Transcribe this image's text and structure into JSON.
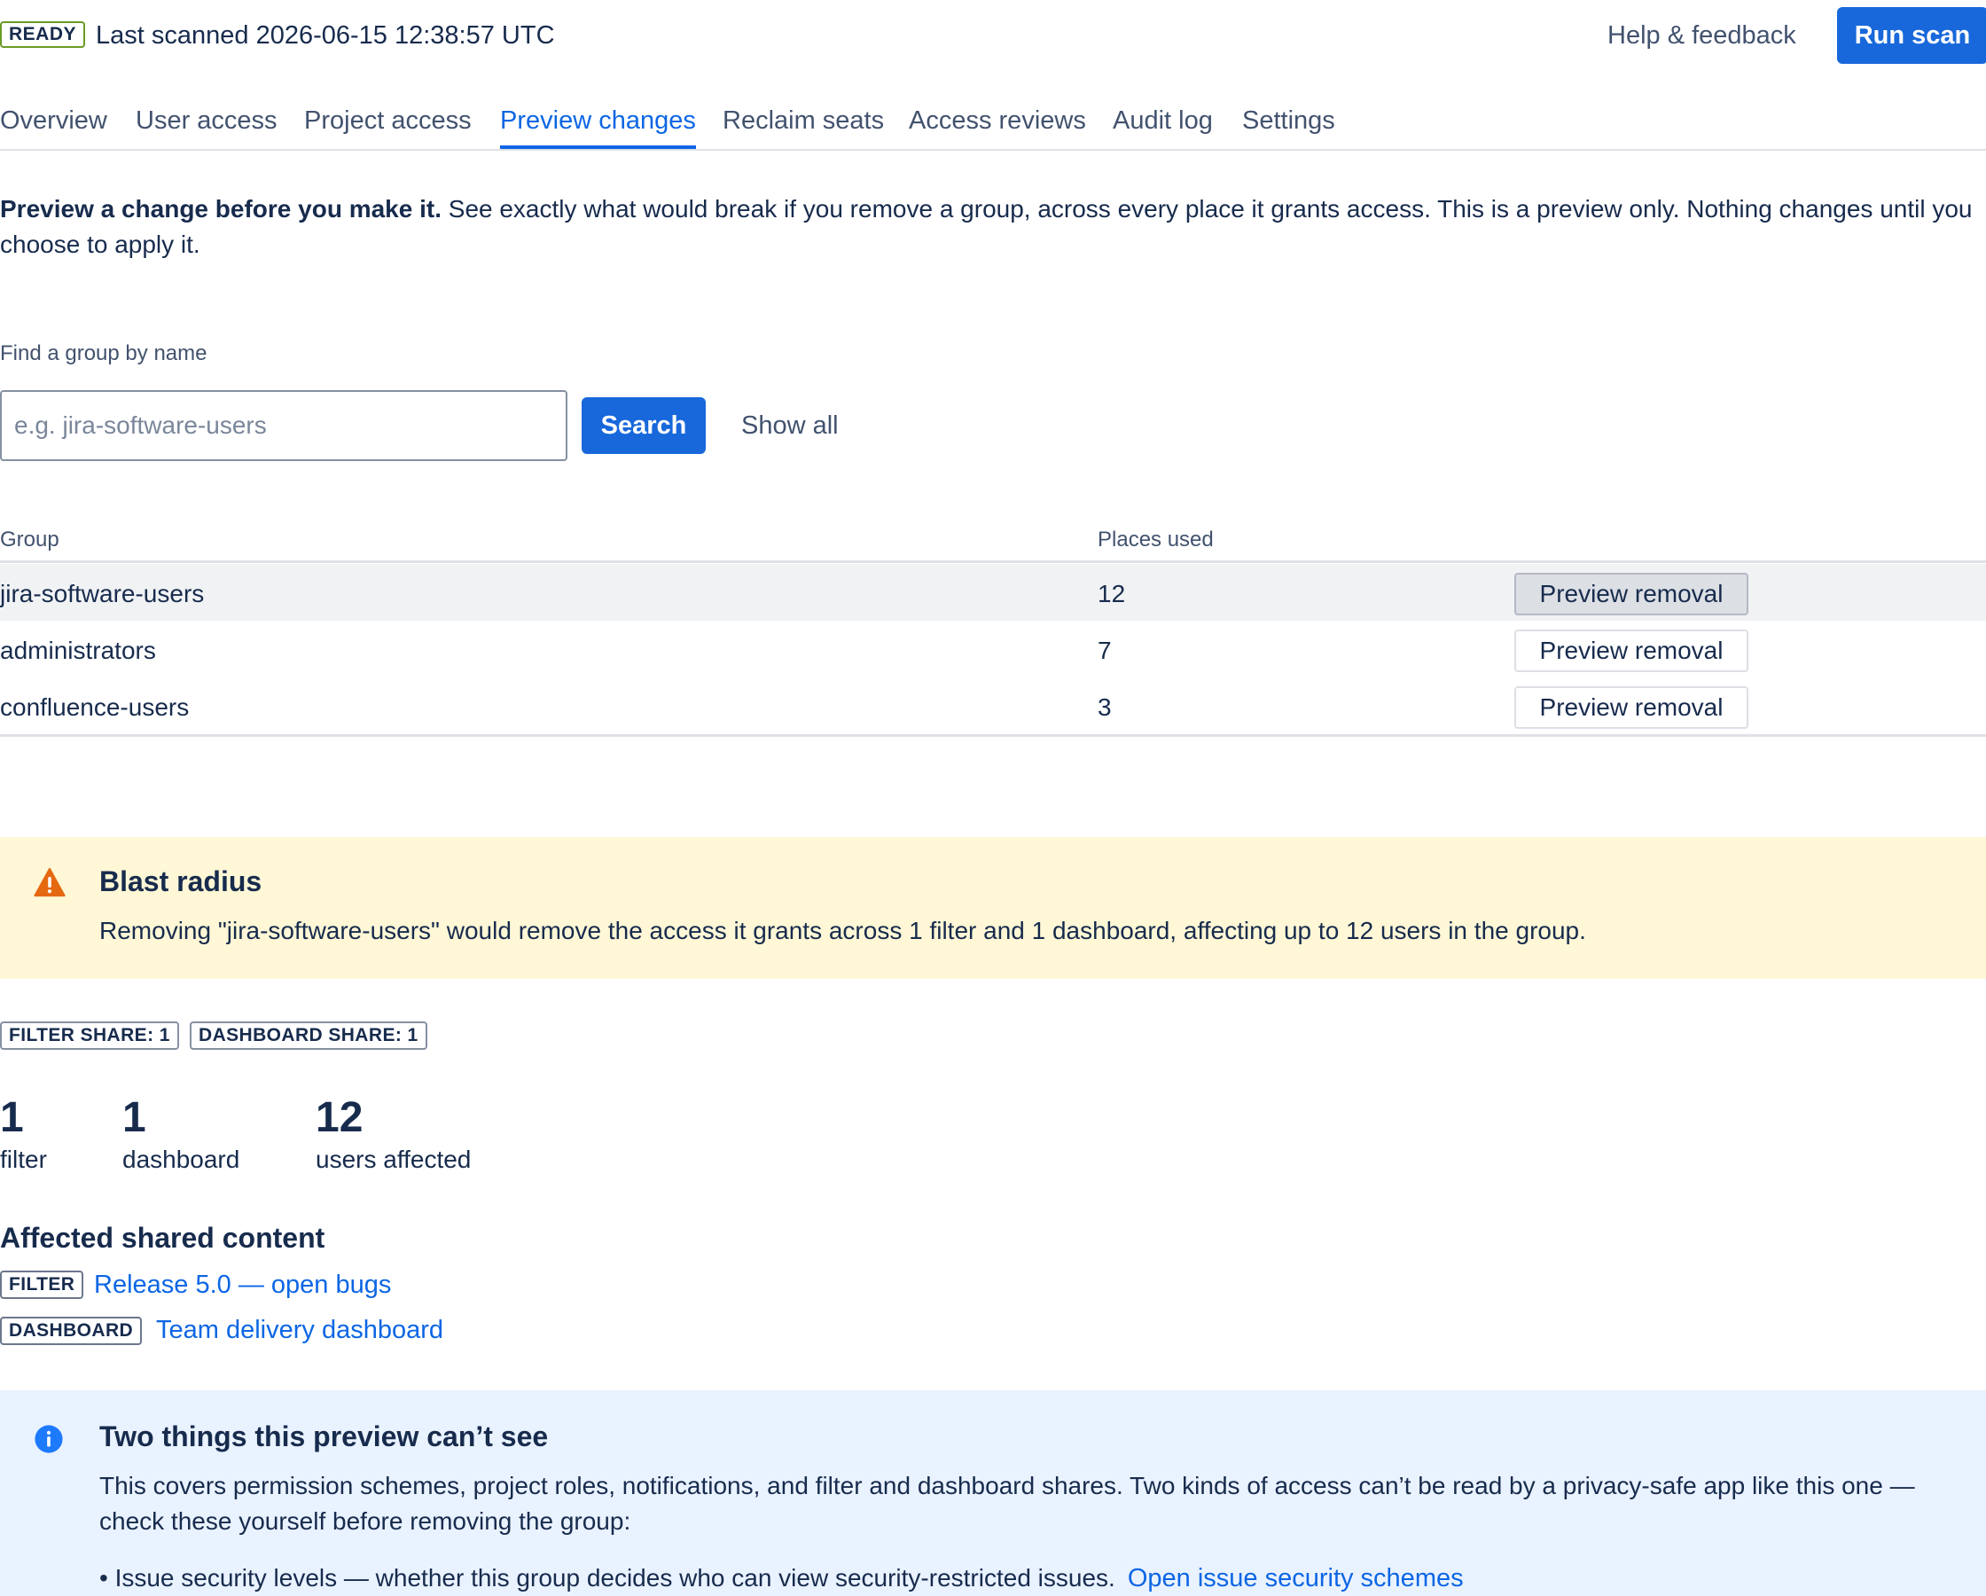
{
  "header": {
    "status_badge": "READY",
    "last_scanned": "Last scanned 2026-06-15 12:38:57 UTC",
    "help_label": "Help & feedback",
    "run_scan_label": "Run scan"
  },
  "tabs": [
    {
      "label": "Overview",
      "active": false
    },
    {
      "label": "User access",
      "active": false
    },
    {
      "label": "Project access",
      "active": false
    },
    {
      "label": "Preview changes",
      "active": true
    },
    {
      "label": "Reclaim seats",
      "active": false
    },
    {
      "label": "Access reviews",
      "active": false
    },
    {
      "label": "Audit log",
      "active": false
    },
    {
      "label": "Settings",
      "active": false
    }
  ],
  "intro": {
    "lead": "Preview a change before you make it.",
    "body": " See exactly what would break if you remove a group, across every place it grants access. This is a preview only. Nothing changes until you choose to apply it."
  },
  "search": {
    "label": "Find a group by name",
    "value": "",
    "placeholder": "e.g. jira-software-users",
    "search_label": "Search",
    "show_all_label": "Show all"
  },
  "table": {
    "columns": {
      "group": "Group",
      "places": "Places used"
    },
    "rows": [
      {
        "group": "jira-software-users",
        "places": "12",
        "action": "Preview removal"
      },
      {
        "group": "administrators",
        "places": "7",
        "action": "Preview removal"
      },
      {
        "group": "confluence-users",
        "places": "3",
        "action": "Preview removal"
      }
    ]
  },
  "blast_radius": {
    "icon": "warning-icon",
    "title": "Blast radius",
    "body": "Removing \"jira-software-users\" would remove the access it grants across 1 filter and 1 dashboard, affecting up to 12 users in the group."
  },
  "counts": {
    "filter_share": "FILTER SHARE: 1",
    "dashboard_share": "DASHBOARD SHARE: 1"
  },
  "stats": [
    {
      "value": "1",
      "label": "filter"
    },
    {
      "value": "1",
      "label": "dashboard"
    },
    {
      "value": "12",
      "label": "users affected"
    }
  ],
  "affected": {
    "title": "Affected shared content",
    "items": [
      {
        "type": "FILTER",
        "name": "Release 5.0 — open bugs"
      },
      {
        "type": "DASHBOARD",
        "name": "Team delivery dashboard"
      }
    ]
  },
  "info": {
    "icon": "info-icon",
    "title": "Two things this preview can’t see",
    "body": "This covers permission schemes, project roles, notifications, and filter and dashboard shares. Two kinds of access can’t be read by a privacy-safe app like this one — check these yourself before removing the group:",
    "bullet_text": "• Issue security levels — whether this group decides who can view security-restricted issues.",
    "bullet_link": "Open issue security schemes"
  },
  "colors": {
    "primary": "#1868db",
    "link": "#0c66e4",
    "warning_bg": "#fff7d6",
    "warning_icon": "#e56910",
    "info_bg": "#e9f2ff",
    "info_icon": "#1d7afc",
    "ready_border": "#6a9a23"
  }
}
